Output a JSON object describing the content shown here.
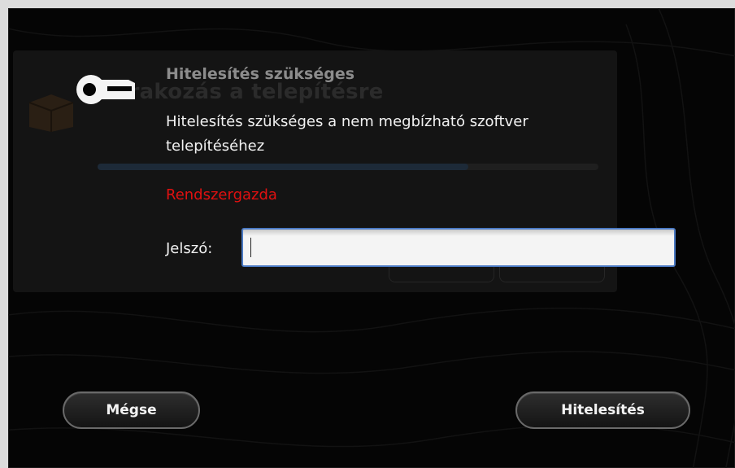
{
  "dialog": {
    "icon": "key-icon",
    "title": "Hitelesítés szükséges",
    "message": "Hitelesítés szükséges a nem megbízható szoftver telepítéséhez",
    "user": "Rendszergazda",
    "password_label": "Jelszó:",
    "password_value": "",
    "cancel_label": "Mégse",
    "authenticate_label": "Hitelesítés"
  },
  "background_window": {
    "icon": "package-icon",
    "title": "Várakozás a telepítésre",
    "progress": 0.74
  },
  "colors": {
    "user_text": "#e01010",
    "input_focus_border": "#4a79c3",
    "dialog_background": "#050505"
  }
}
